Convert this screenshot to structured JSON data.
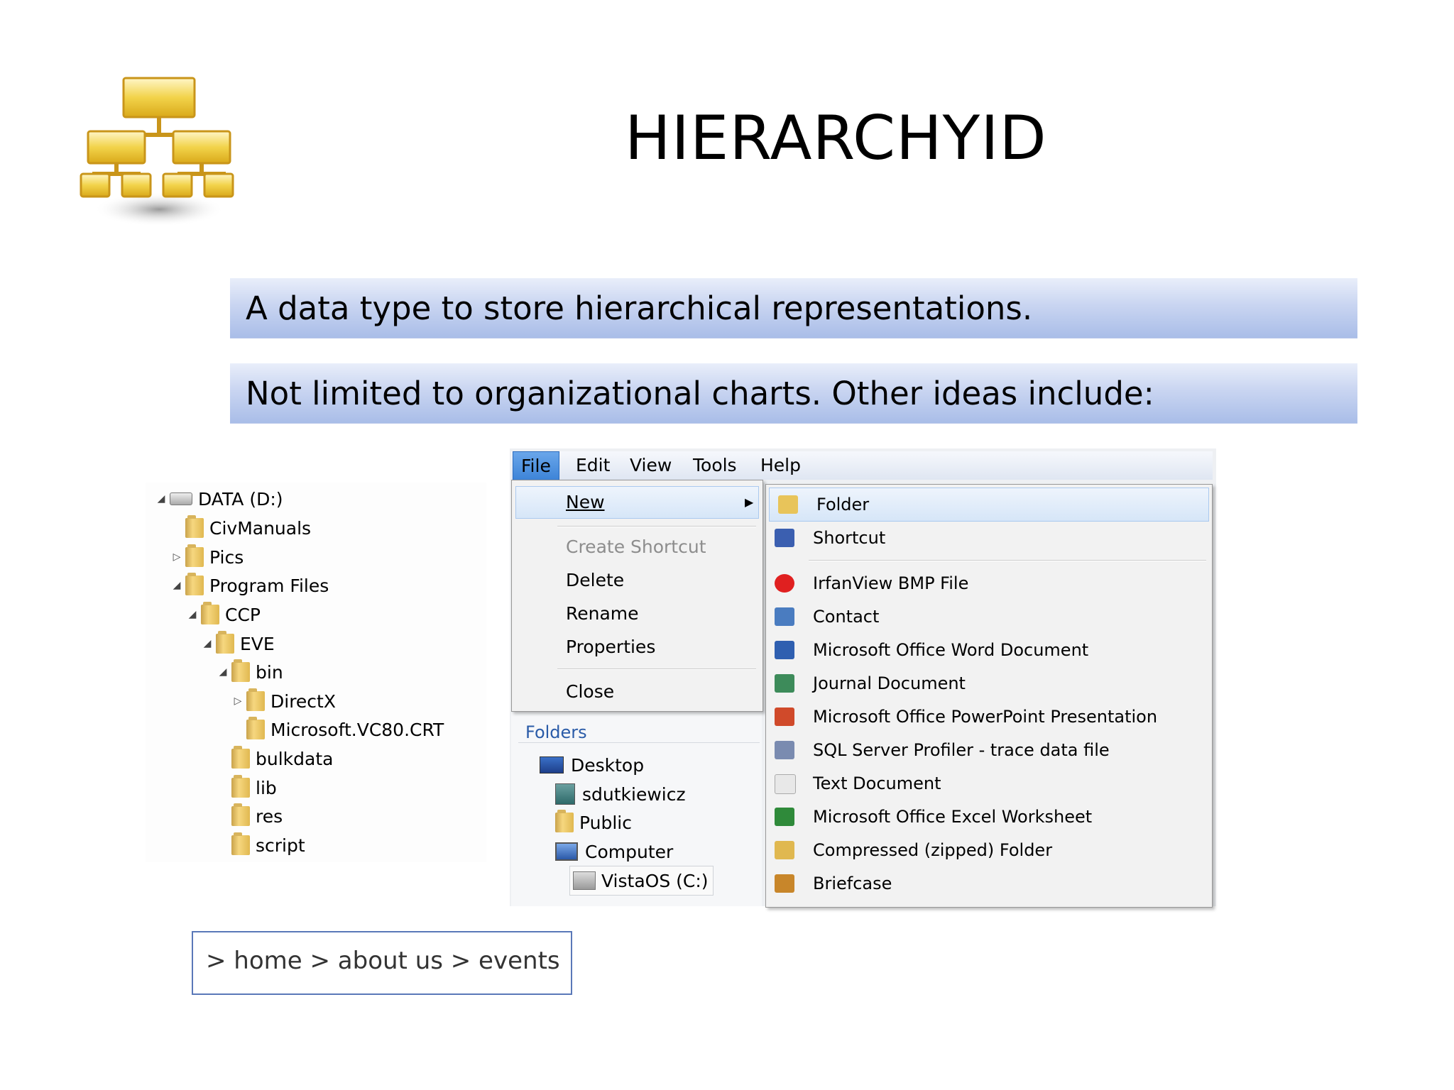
{
  "slide": {
    "title": "HIERARCHYID",
    "point1": "A data type to store hierarchical representations.",
    "point2": "Not limited to organizational charts.  Other ideas include:"
  },
  "tree": {
    "items": [
      {
        "label": "DATA (D:)",
        "expander": "◢"
      },
      {
        "label": "CivManuals",
        "expander": ""
      },
      {
        "label": "Pics",
        "expander": "▷"
      },
      {
        "label": "Program Files",
        "expander": "◢"
      },
      {
        "label": "CCP",
        "expander": "◢"
      },
      {
        "label": "EVE",
        "expander": "◢"
      },
      {
        "label": "bin",
        "expander": "◢"
      },
      {
        "label": "DirectX",
        "expander": "▷"
      },
      {
        "label": "Microsoft.VC80.CRT",
        "expander": ""
      },
      {
        "label": "bulkdata",
        "expander": ""
      },
      {
        "label": "lib",
        "expander": ""
      },
      {
        "label": "res",
        "expander": ""
      },
      {
        "label": "script",
        "expander": ""
      }
    ]
  },
  "menubar": {
    "file": "File",
    "edit": "Edit",
    "view": "View",
    "tools": "Tools",
    "help": "Help"
  },
  "file_menu": {
    "new": "New",
    "create_shortcut": "Create Shortcut",
    "delete": "Delete",
    "rename": "Rename",
    "properties": "Properties",
    "close": "Close"
  },
  "folders_pane": {
    "header": "Folders",
    "items": [
      "Desktop",
      "sdutkiewicz",
      "Public",
      "Computer",
      "VistaOS (C:)"
    ]
  },
  "new_menu": {
    "items": [
      {
        "label": "Folder",
        "icon": "folder-icon",
        "color": "#e8c45a"
      },
      {
        "label": "Shortcut",
        "icon": "shortcut-icon",
        "color": "#3b5fb0"
      },
      {
        "label": "IrfanView BMP File",
        "icon": "irfanview-icon",
        "color": "#e02020"
      },
      {
        "label": "Contact",
        "icon": "contact-icon",
        "color": "#4a7cc0"
      },
      {
        "label": "Microsoft Office Word Document",
        "icon": "word-document-icon",
        "color": "#2f5fb0"
      },
      {
        "label": "Journal Document",
        "icon": "journal-document-icon",
        "color": "#3d8b5a"
      },
      {
        "label": "Microsoft Office PowerPoint Presentation",
        "icon": "powerpoint-icon",
        "color": "#d04a2a"
      },
      {
        "label": "SQL Server Profiler - trace data file",
        "icon": "sql-profiler-icon",
        "color": "#7a8bb0"
      },
      {
        "label": "Text Document",
        "icon": "text-document-icon",
        "color": "#e8e8e8"
      },
      {
        "label": "Microsoft Office Excel Worksheet",
        "icon": "excel-icon",
        "color": "#2f8a3a"
      },
      {
        "label": "Compressed (zipped) Folder",
        "icon": "zip-folder-icon",
        "color": "#e0b850"
      },
      {
        "label": "Briefcase",
        "icon": "briefcase-icon",
        "color": "#c8862a"
      }
    ]
  },
  "breadcrumb": {
    "text": "> home > about us > events"
  }
}
